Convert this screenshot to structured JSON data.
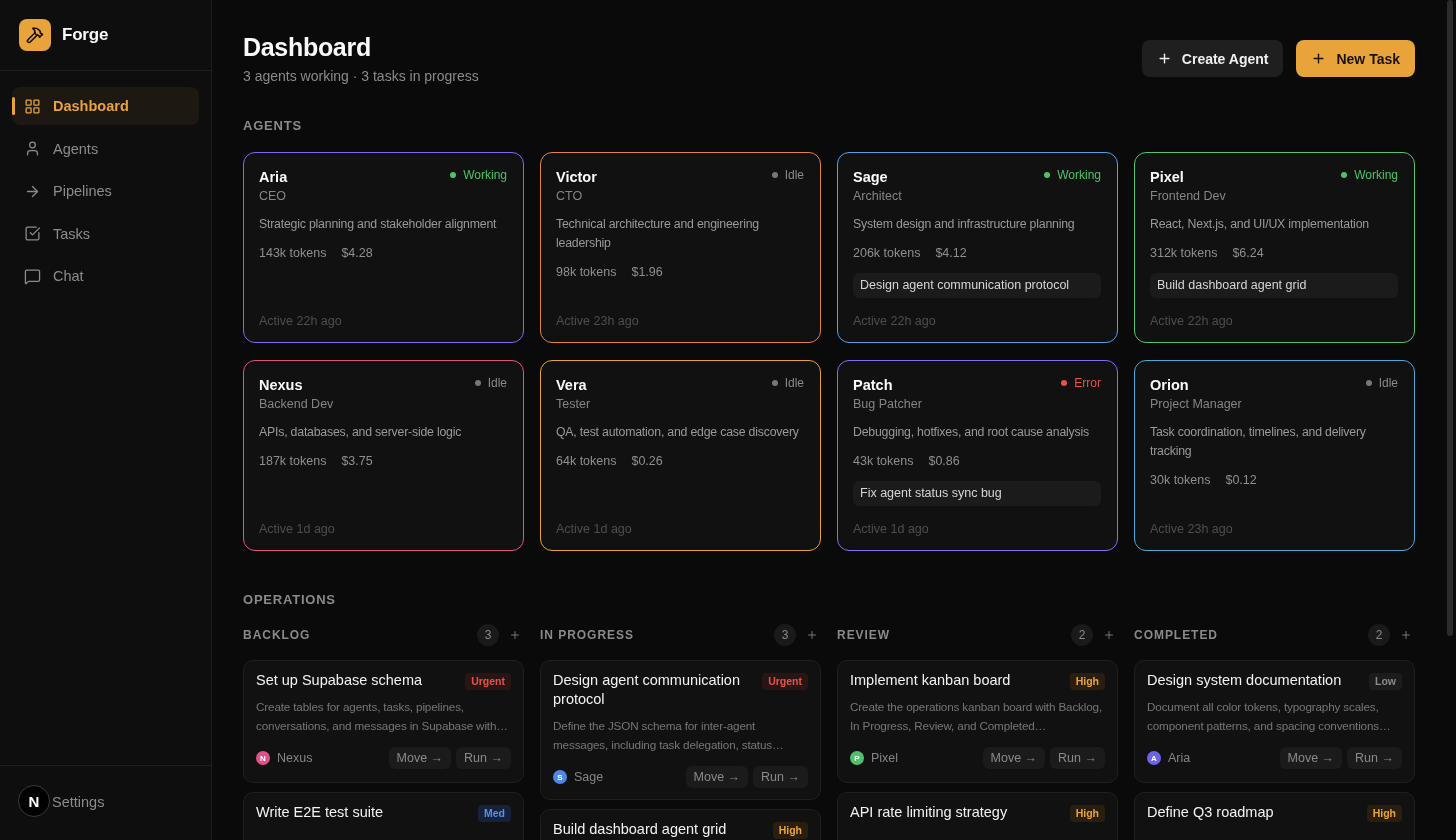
{
  "sidebar": {
    "brand": "Forge",
    "items": [
      {
        "label": "Dashboard",
        "selected": true
      },
      {
        "label": "Agents",
        "selected": false
      },
      {
        "label": "Pipelines",
        "selected": false
      },
      {
        "label": "Tasks",
        "selected": false
      },
      {
        "label": "Chat",
        "selected": false
      }
    ],
    "footer_item": "Settings",
    "dev_badge": "N"
  },
  "header": {
    "title": "Dashboard",
    "subtitle": "3 agents working · 3 tasks in progress",
    "buttons": [
      {
        "label": "Create Agent",
        "kind": "secondary"
      },
      {
        "label": "New Task",
        "kind": "primary"
      }
    ]
  },
  "agents": {
    "heading": "AGENTS",
    "cards": [
      {
        "name": "Aria",
        "role": "CEO",
        "status": {
          "label": "Working",
          "kind": "working"
        },
        "description": "Strategic planning and stakeholder alignment",
        "tokens": "143k tokens",
        "cost": "$4.28",
        "last_active": "Active 22h ago",
        "color": "#7a6cf0"
      },
      {
        "name": "Victor",
        "role": "CTO",
        "status": {
          "label": "Idle",
          "kind": "idle"
        },
        "description": "Technical architecture and engineering leadership",
        "tokens": "98k tokens",
        "cost": "$1.96",
        "last_active": "Active 23h ago",
        "color": "#e5823f"
      },
      {
        "name": "Sage",
        "role": "Architect",
        "status": {
          "label": "Working",
          "kind": "working"
        },
        "description": "System design and infrastructure planning",
        "tokens": "206k tokens",
        "cost": "$4.12",
        "current_task": "Design agent communication protocol",
        "last_active": "Active 22h ago",
        "color": "#5a9fe6"
      },
      {
        "name": "Pixel",
        "role": "Frontend Dev",
        "status": {
          "label": "Working",
          "kind": "working"
        },
        "description": "React, Next.js, and UI/UX implementation",
        "tokens": "312k tokens",
        "cost": "$6.24",
        "current_task": "Build dashboard agent grid",
        "last_active": "Active 22h ago",
        "color": "#52c27a"
      },
      {
        "name": "Nexus",
        "role": "Backend Dev",
        "status": {
          "label": "Idle",
          "kind": "idle"
        },
        "description": "APIs, databases, and server-side logic",
        "tokens": "187k tokens",
        "cost": "$3.75",
        "last_active": "Active 1d ago",
        "color": "#e0557a"
      },
      {
        "name": "Vera",
        "role": "Tester",
        "status": {
          "label": "Idle",
          "kind": "idle"
        },
        "description": "QA, test automation, and edge case discovery",
        "tokens": "64k tokens",
        "cost": "$0.26",
        "last_active": "Active 1d ago",
        "color": "#e8a33a"
      },
      {
        "name": "Patch",
        "role": "Bug Patcher",
        "status": {
          "label": "Error",
          "kind": "error"
        },
        "description": "Debugging, hotfixes, and root cause analysis",
        "tokens": "43k tokens",
        "cost": "$0.86",
        "current_task": "Fix agent status sync bug",
        "last_active": "Active 1d ago",
        "color": "#8a6cf0"
      },
      {
        "name": "Orion",
        "role": "Project Manager",
        "status": {
          "label": "Idle",
          "kind": "idle"
        },
        "description": "Task coordination, timelines, and delivery tracking",
        "tokens": "30k tokens",
        "cost": "$0.12",
        "last_active": "Active 23h ago",
        "color": "#4ea8dc"
      }
    ]
  },
  "operations": {
    "heading": "OPERATIONS",
    "columns": [
      {
        "title": "BACKLOG",
        "count": "3",
        "tasks": [
          {
            "title": "Set up Supabase schema",
            "priority": {
              "label": "Urgent",
              "kind": "urgent"
            },
            "description": "Create tables for agents, tasks, pipelines, conversations, and messages in Supabase with…",
            "assignee": {
              "initial": "N",
              "name": "Nexus",
              "color": "#e0508a"
            },
            "actions": [
              "Move →",
              "Run →"
            ]
          },
          {
            "title": "Write E2E test suite",
            "priority": {
              "label": "Med",
              "kind": "medium"
            }
          }
        ]
      },
      {
        "title": "IN PROGRESS",
        "count": "3",
        "tasks": [
          {
            "title": "Design agent communication protocol",
            "priority": {
              "label": "Urgent",
              "kind": "urgent"
            },
            "description": "Define the JSON schema for inter-agent messages, including task delegation, status…",
            "assignee": {
              "initial": "S",
              "name": "Sage",
              "color": "#4f86e8"
            },
            "actions": [
              "Move →",
              "Run →"
            ]
          },
          {
            "title": "Build dashboard agent grid",
            "priority": {
              "label": "High",
              "kind": "high"
            }
          }
        ]
      },
      {
        "title": "REVIEW",
        "count": "2",
        "tasks": [
          {
            "title": "Implement kanban board",
            "priority": {
              "label": "High",
              "kind": "high"
            },
            "description": "Create the operations kanban board with Backlog, In Progress, Review, and Completed…",
            "assignee": {
              "initial": "P",
              "name": "Pixel",
              "color": "#4cc36a"
            },
            "actions": [
              "Move →",
              "Run →"
            ]
          },
          {
            "title": "API rate limiting strategy",
            "priority": {
              "label": "High",
              "kind": "high"
            }
          }
        ]
      },
      {
        "title": "COMPLETED",
        "count": "2",
        "tasks": [
          {
            "title": "Design system documentation",
            "priority": {
              "label": "Low",
              "kind": "low"
            },
            "description": "Document all color tokens, typography scales, component patterns, and spacing conventions…",
            "assignee": {
              "initial": "A",
              "name": "Aria",
              "color": "#6b63e8"
            },
            "actions": [
              "Move →",
              "Run →"
            ]
          },
          {
            "title": "Define Q3 roadmap",
            "priority": {
              "label": "High",
              "kind": "high"
            }
          }
        ]
      }
    ]
  }
}
